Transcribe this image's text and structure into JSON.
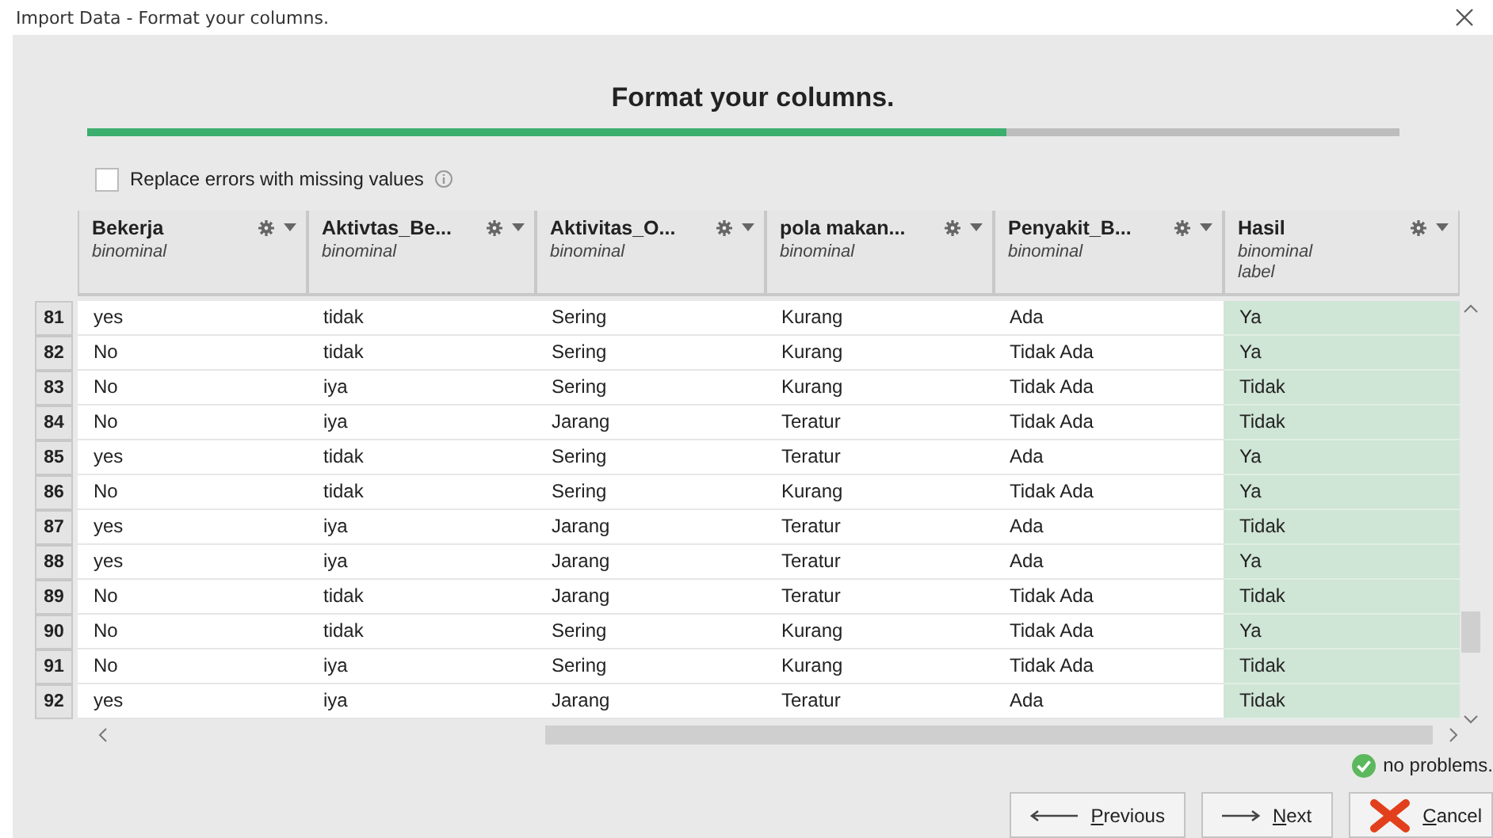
{
  "window": {
    "title": "Import Data - Format your columns."
  },
  "heading": "Format your columns.",
  "progress": {
    "level": 0.7
  },
  "replace_errors": {
    "label": "Replace errors with missing values",
    "checked": false
  },
  "table": {
    "columns": [
      {
        "name": "Bekerja",
        "type": "binominal"
      },
      {
        "name": "Aktivtas_Be...",
        "type": "binominal"
      },
      {
        "name": "Aktivitas_O...",
        "type": "binominal"
      },
      {
        "name": "pola makan...",
        "type": "binominal"
      },
      {
        "name": "Penyakit_B...",
        "type": "binominal"
      },
      {
        "name": "Hasil",
        "type": "binominal",
        "role": "label"
      }
    ],
    "rows": [
      {
        "number": "81",
        "cells": [
          "yes",
          "tidak",
          "Sering",
          "Kurang",
          "Ada",
          "Ya"
        ]
      },
      {
        "number": "82",
        "cells": [
          "No",
          "tidak",
          "Sering",
          "Kurang",
          "Tidak Ada",
          "Ya"
        ]
      },
      {
        "number": "83",
        "cells": [
          "No",
          "iya",
          "Sering",
          "Kurang",
          "Tidak Ada",
          "Tidak"
        ]
      },
      {
        "number": "84",
        "cells": [
          "No",
          "iya",
          "Jarang",
          "Teratur",
          "Tidak Ada",
          "Tidak"
        ]
      },
      {
        "number": "85",
        "cells": [
          "yes",
          "tidak",
          "Sering",
          "Teratur",
          "Ada",
          "Ya"
        ]
      },
      {
        "number": "86",
        "cells": [
          "No",
          "tidak",
          "Sering",
          "Kurang",
          "Tidak Ada",
          "Ya"
        ]
      },
      {
        "number": "87",
        "cells": [
          "yes",
          "iya",
          "Jarang",
          "Teratur",
          "Ada",
          "Tidak"
        ]
      },
      {
        "number": "88",
        "cells": [
          "yes",
          "iya",
          "Jarang",
          "Teratur",
          "Ada",
          "Ya"
        ]
      },
      {
        "number": "89",
        "cells": [
          "No",
          "tidak",
          "Jarang",
          "Teratur",
          "Tidak Ada",
          "Tidak"
        ]
      },
      {
        "number": "90",
        "cells": [
          "No",
          "tidak",
          "Sering",
          "Kurang",
          "Tidak Ada",
          "Ya"
        ]
      },
      {
        "number": "91",
        "cells": [
          "No",
          "iya",
          "Sering",
          "Kurang",
          "Tidak Ada",
          "Tidak"
        ]
      },
      {
        "number": "92",
        "cells": [
          "yes",
          "iya",
          "Jarang",
          "Teratur",
          "Ada",
          "Tidak"
        ]
      }
    ]
  },
  "status": "no problems.",
  "buttons": [
    {
      "kind": "previous",
      "label": "Previous"
    },
    {
      "kind": "next",
      "label": "Next"
    },
    {
      "kind": "cancel",
      "label": "Cancel"
    }
  ]
}
